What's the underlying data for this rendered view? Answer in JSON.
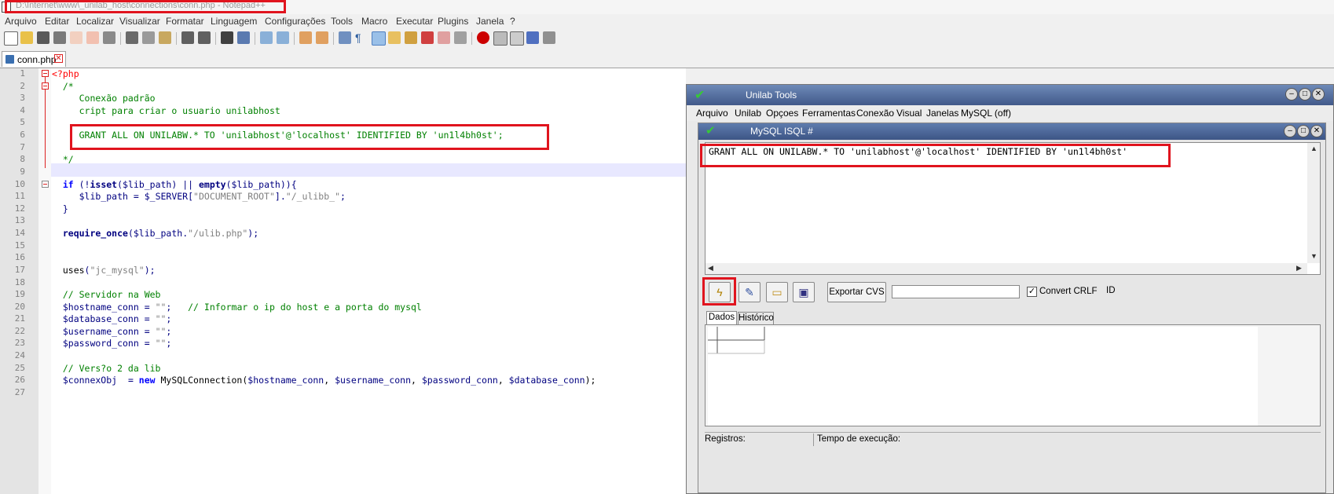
{
  "window": {
    "title": "D:\\Internet\\www\\_unilab_host\\connections\\conn.php - Notepad++"
  },
  "menu": [
    "Arquivo",
    "Editar",
    "Localizar",
    "Visualizar",
    "Formatar",
    "Linguagem",
    "Configurações",
    "Tools",
    "Macro",
    "Executar",
    "Plugins",
    "Janela",
    "?"
  ],
  "toolbar_icons": [
    "new-file-icon",
    "open-file-icon",
    "save-icon",
    "save-all-icon",
    "close-icon",
    "close-all-icon",
    "print-icon",
    "cut-icon",
    "copy-icon",
    "paste-icon",
    "undo-icon",
    "redo-icon",
    "find-icon",
    "replace-icon",
    "zoom-in-icon",
    "zoom-out-icon",
    "sync-v-icon",
    "sync-h-icon",
    "word-wrap-icon",
    "show-all-chars-icon",
    "indent-guide-icon",
    "doc-map-icon",
    "function-list-icon",
    "folder-workspace-icon",
    "monitor-icon",
    "eye-icon",
    "record-macro-icon",
    "stop-macro-icon",
    "play-macro-icon",
    "run-multiple-icon",
    "save-macro-icon"
  ],
  "tab": {
    "label": "conn.php"
  },
  "editor": {
    "line_numbers": [
      "1",
      "2",
      "3",
      "4",
      "5",
      "6",
      "7",
      "8",
      "9",
      "10",
      "11",
      "12",
      "13",
      "14",
      "15",
      "16",
      "17",
      "18",
      "19",
      "20",
      "21",
      "22",
      "23",
      "24",
      "25",
      "26",
      "27"
    ],
    "lines": {
      "l1": "<?php",
      "l2": "  /*",
      "l3": "     Conexão padrão",
      "l4": "     cript para criar o usuario unilabhost",
      "l6": "     GRANT ALL ON UNILABW.* TO 'unilabhost'@'localhost' IDENTIFIED BY 'un1l4bh0st';",
      "l8": "  */",
      "l10a": "  if",
      "l10b": " (!",
      "l10c": "isset",
      "l10d": "(",
      "l10e": "$lib_path",
      "l10f": ") || ",
      "l10g": "empty",
      "l10h": "(",
      "l10i": "$lib_path",
      "l10j": ")){",
      "l11a": "     $lib_path",
      "l11b": " = ",
      "l11c": "$_SERVER",
      "l11d": "[",
      "l11e": "\"DOCUMENT_ROOT\"",
      "l11f": "].",
      "l11g": "\"/_ulibb_\"",
      "l11h": ";",
      "l12": "  }",
      "l14a": "  require_once",
      "l14b": "(",
      "l14c": "$lib_path",
      "l14d": ".",
      "l14e": "\"/ulib.php\"",
      "l14f": ");",
      "l17a": "  uses",
      "l17b": "(",
      "l17c": "\"jc_mysql\"",
      "l17d": ");",
      "l19": "  // Servidor na Web",
      "l20a": "  $hostname_conn",
      "l20b": " = ",
      "l20c": "\"\"",
      "l20d": ";",
      "l20e": "   // Informar o ip do host e a porta do mysql",
      "l21a": "  $database_conn",
      "l21b": " = ",
      "l21c": "\"\"",
      "l21d": ";",
      "l22a": "  $username_conn",
      "l22b": " = ",
      "l22c": "\"\"",
      "l22d": ";",
      "l23a": "  $password_conn",
      "l23b": " = ",
      "l23c": "\"\"",
      "l23d": ";",
      "l25": "  // Vers?o 2 da lib",
      "l26a": "  $connexObj",
      "l26b": "  = ",
      "l26c": "new",
      "l26d": " MySQLConnection(",
      "l26e": "$hostname_conn",
      "l26f": ", ",
      "l26g": "$username_conn",
      "l26h": ", ",
      "l26i": "$password_conn",
      "l26j": ", ",
      "l26k": "$database_conn",
      "l26l": ");"
    }
  },
  "unilab": {
    "title": "Unilab Tools",
    "menu": [
      "Arquivo",
      "Unilab",
      "Opçoes",
      "Ferramentas",
      "Conexão",
      "Visual",
      "Janelas",
      "MySQL (off)"
    ],
    "inner": {
      "title": "MySQL ISQL #",
      "sql_text": "GRANT ALL ON UNILABW.* TO 'unilabhost'@'localhost' IDENTIFIED BY 'un1l4bh0st'",
      "export_button": "Exportar CVS",
      "export_value": "",
      "crlf_label": "Convert CRLF",
      "crlf_checked": "✓",
      "id_label": "ID",
      "tabs": [
        "Dados",
        "Histórico"
      ],
      "status_records": "Registros:",
      "status_time": "Tempo de execução:"
    }
  },
  "colors": {
    "highlight_box": "#e0141e",
    "comment": "#008000",
    "keyword": "#0000ff",
    "variable": "#000080"
  }
}
